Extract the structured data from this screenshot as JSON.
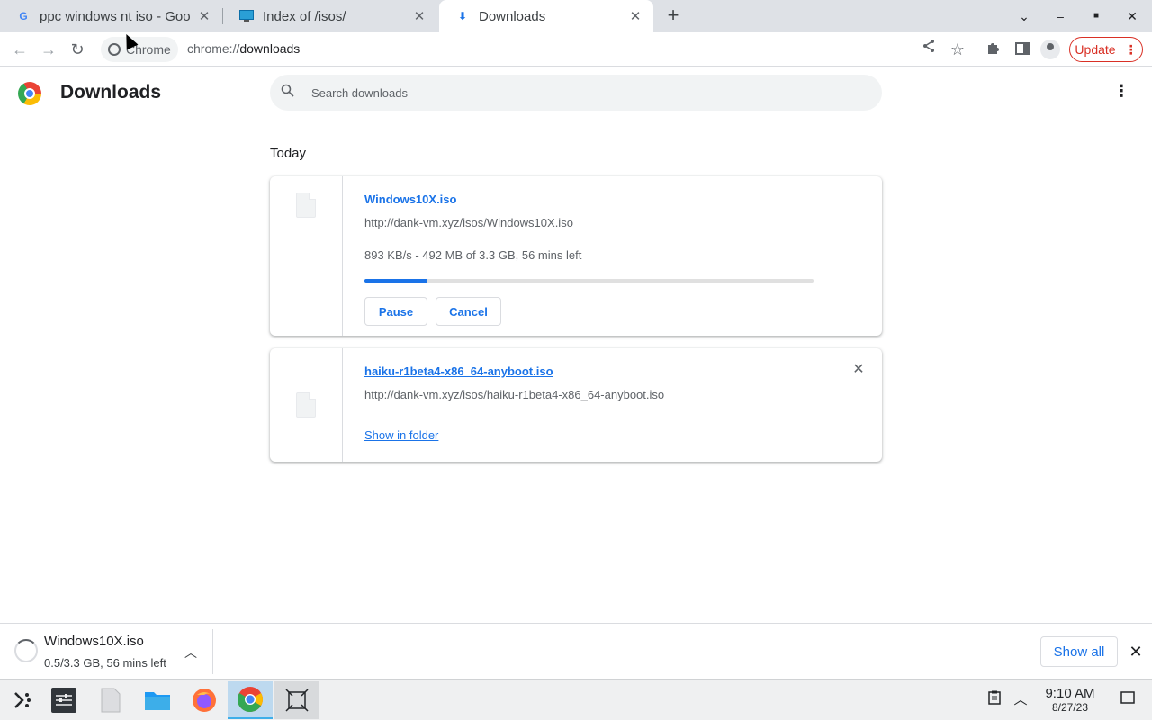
{
  "tabs": [
    {
      "title": "ppc windows nt iso - Goo",
      "favicon": "google-g-icon"
    },
    {
      "title": "Index of /isos/",
      "favicon": "monitor-icon"
    },
    {
      "title": "Downloads",
      "favicon": "download-arrow-icon"
    }
  ],
  "toolbar": {
    "chip_label": "Chrome",
    "url_scheme": "chrome://",
    "url_host": "downloads",
    "update_label": "Update"
  },
  "page": {
    "title": "Downloads",
    "search_placeholder": "Search downloads",
    "section_label": "Today"
  },
  "downloads": [
    {
      "name": "Windows10X.iso",
      "url": "http://dank-vm.xyz/isos/Windows10X.iso",
      "status": "893 KB/s - 492 MB of 3.3 GB, 56 mins left",
      "progress_percent": 14,
      "pause_label": "Pause",
      "cancel_label": "Cancel"
    },
    {
      "name": "haiku-r1beta4-x86_64-anyboot.iso",
      "url": "http://dank-vm.xyz/isos/haiku-r1beta4-x86_64-anyboot.iso",
      "show_in_folder_label": "Show in folder"
    }
  ],
  "shelf": {
    "file_name": "Windows10X.iso",
    "file_status": "0.5/3.3 GB, 56 mins left",
    "show_all_label": "Show all"
  },
  "taskbar": {
    "time": "9:10 AM",
    "date": "8/27/23"
  },
  "colors": {
    "accent": "#1a73e8",
    "update_red": "#d93025",
    "tabstrip_bg": "#dee1e6"
  }
}
